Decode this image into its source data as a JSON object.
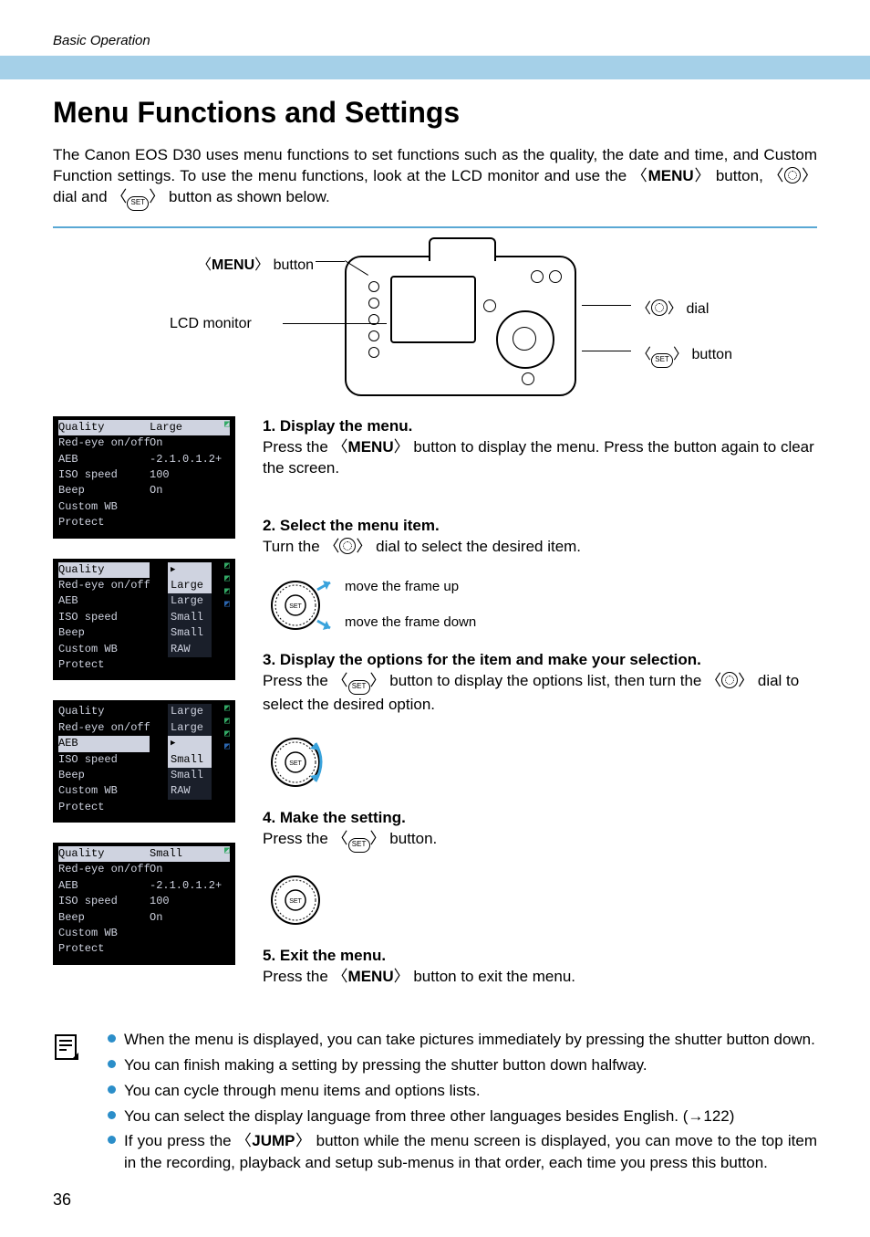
{
  "header": {
    "section": "Basic Operation"
  },
  "title": "Menu Functions and Settings",
  "intro_parts": {
    "a": "The Canon EOS D30 uses menu functions to set functions such as the quality, the date and time, and Custom Function settings. To use the menu functions, look at the LCD monitor and use the ",
    "menu": "MENU",
    "b": " button, ",
    "c": " dial and ",
    "d": " button as shown below."
  },
  "diagram": {
    "menu_button": "MENU",
    "menu_button_suffix": " button",
    "lcd_monitor": "LCD monitor",
    "dial_suffix": " dial",
    "set_suffix": " button"
  },
  "lcd_common": {
    "rows": [
      "Quality",
      "Red-eye on/off",
      "AEB",
      "ISO speed",
      "Beep",
      "Custom WB",
      "Protect"
    ],
    "aeb_scale": "-2.1.0.1.2+",
    "options": [
      "Large",
      "Large",
      "Small",
      "Small",
      "RAW"
    ]
  },
  "screens": {
    "s1": {
      "quality": "Large",
      "redeye": "On",
      "iso": "100",
      "beep": "On"
    },
    "s2": {
      "left_quality": "Quality",
      "sel_index": 0
    },
    "s3": {
      "sel_index": 2
    },
    "s4": {
      "quality": "Small",
      "redeye": "On",
      "iso": "100",
      "beep": "On"
    }
  },
  "steps": {
    "s1": {
      "h": "1. Display the menu.",
      "a": "Press the ",
      "menu": "MENU",
      "b": " button to display the menu. Press the button again to clear the screen."
    },
    "s2": {
      "h": "2. Select the menu item.",
      "a": "Turn the ",
      "b": " dial to select the desired item.",
      "up": "move the frame up",
      "down": "move the frame down"
    },
    "s3": {
      "h": "3.  Display the options for the item and make your selection.",
      "a": "Press the ",
      "b": " button to display the options list, then turn the ",
      "c": " dial to select the desired option."
    },
    "s4": {
      "h": "4. Make the setting.",
      "a": "Press the ",
      "b": " button."
    },
    "s5": {
      "h": "5. Exit the menu.",
      "a": "Press the ",
      "menu": "MENU",
      "b": " button to exit the menu."
    }
  },
  "notes": {
    "n1": "When the menu is displayed, you can take pictures immediately by pressing the shutter button down.",
    "n2": "You can finish making a setting by pressing the shutter button down halfway.",
    "n3": "You can cycle through menu items and options lists.",
    "n4": "You can select the display language from three other languages besides English. (→122)",
    "n5a": "If you press the ",
    "n5_jump": "JUMP",
    "n5b": " button while the menu screen is displayed, you can move to the top item in the recording, playback and setup sub-menus in that order, each time you press this button."
  },
  "page_number": "36"
}
